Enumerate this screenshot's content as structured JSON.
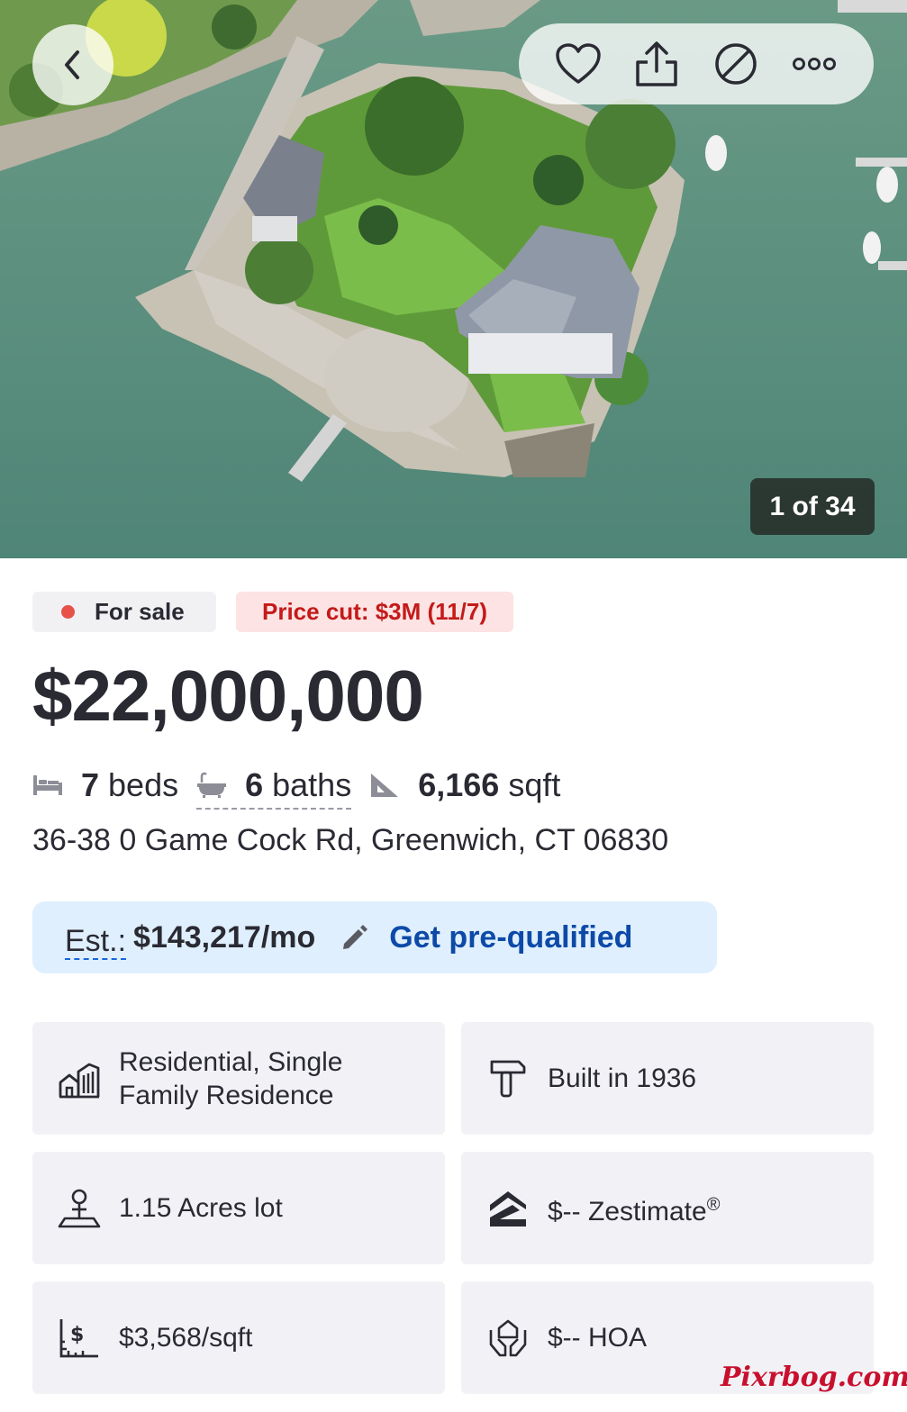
{
  "hero": {
    "photo_counter": "1 of 34",
    "actions": [
      "heart-icon",
      "share-icon",
      "hide-icon",
      "more-icon"
    ]
  },
  "status": {
    "for_sale": "For sale",
    "price_cut": "Price cut: $3M (11/7)"
  },
  "price": "$22,000,000",
  "facts": {
    "beds_num": "7",
    "beds_label": "beds",
    "baths_num": "6",
    "baths_label": "baths",
    "sqft_num": "6,166",
    "sqft_label": "sqft"
  },
  "address": "36-38 0 Game Cock Rd, Greenwich, CT 06830",
  "estimate": {
    "label": "Est.:",
    "amount": "$143,217/mo",
    "cta": "Get pre-qualified"
  },
  "tiles": {
    "type": "Residential, Single Family Residence",
    "type_line1": "Residential, Single",
    "type_line2": "Family Residence",
    "built": "Built in 1936",
    "lot": "1.15 Acres lot",
    "zestimate": "$-- Zestimate",
    "zestimate_mark": "®",
    "price_per_sqft": "$3,568/sqft",
    "hoa": "$-- HOA"
  },
  "watermark": "Pixrbog.com",
  "colors": {
    "water": "#5e8f80",
    "sale_dot": "#e8504a",
    "price_cut_bg": "#fde3e3",
    "price_cut_text": "#c41a1a",
    "estimate_bg": "#dfeffd",
    "link": "#0d4aa8"
  }
}
